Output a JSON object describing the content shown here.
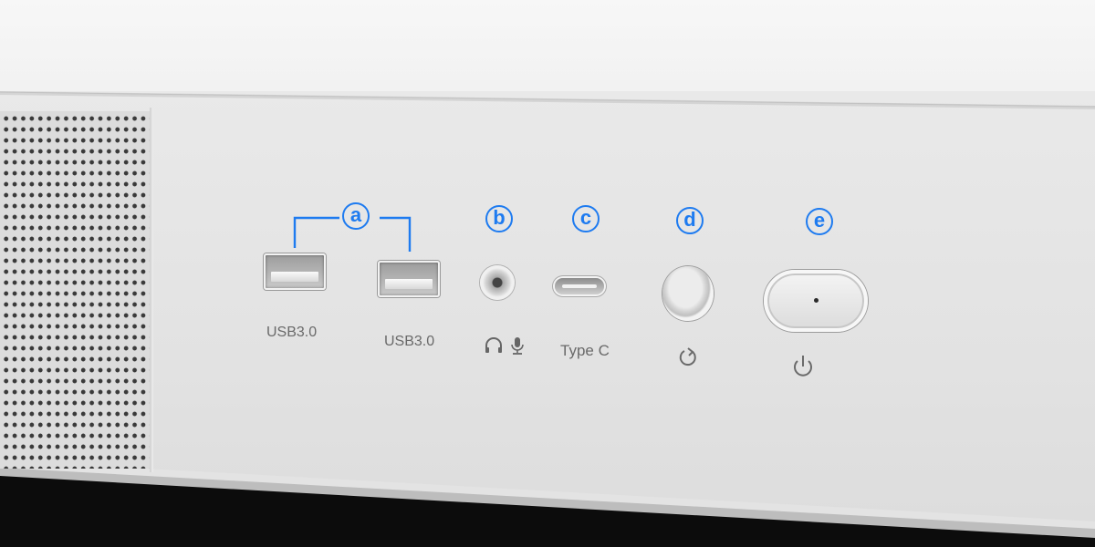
{
  "callouts": {
    "a": "a",
    "b": "b",
    "c": "c",
    "d": "d",
    "e": "e"
  },
  "labels": {
    "usb_left": "USB3.0",
    "usb_right": "USB3.0",
    "type_c": "Type C"
  },
  "icons": {
    "audio": [
      "headphone-icon",
      "microphone-icon"
    ],
    "reset": "reset-arrow-icon",
    "power": "power-icon"
  },
  "colors": {
    "callout": "#1e7bf0",
    "panel": "#e6e6e6",
    "label_text": "#6a6a6a"
  }
}
